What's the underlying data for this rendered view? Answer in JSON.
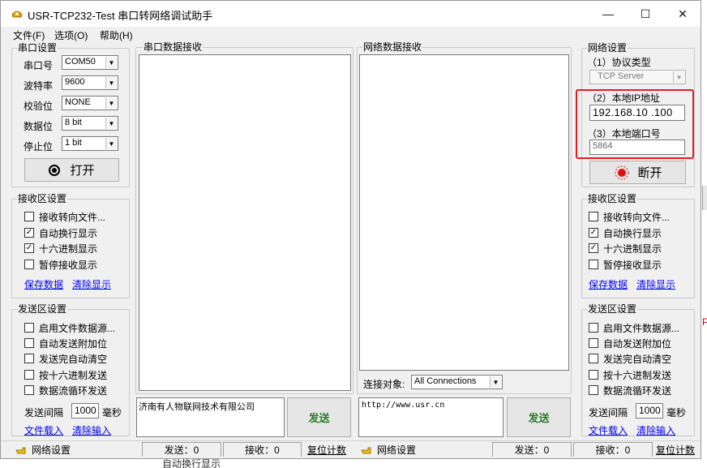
{
  "window": {
    "title": "USR-TCP232-Test 串口转网络调试助手",
    "controls": {
      "minimize": "—",
      "maximize": "☐",
      "close": "✕"
    }
  },
  "menu": [
    "文件(F)",
    "选项(O)",
    "帮助(H)"
  ],
  "serial_settings": {
    "title": "串口设置",
    "fields": [
      {
        "label": "串口号",
        "value": "COM50"
      },
      {
        "label": "波特率",
        "value": "9600"
      },
      {
        "label": "校验位",
        "value": "NONE"
      },
      {
        "label": "数据位",
        "value": "8 bit"
      },
      {
        "label": "停止位",
        "value": "1 bit"
      }
    ],
    "open_button": "打开"
  },
  "left_recv": {
    "title": "接收区设置",
    "options": [
      {
        "label": "接收转向文件...",
        "checked": false
      },
      {
        "label": "自动换行显示",
        "checked": true
      },
      {
        "label": "十六进制显示",
        "checked": true
      },
      {
        "label": "暂停接收显示",
        "checked": false
      }
    ],
    "save_link": "保存数据",
    "clear_link": "清除显示"
  },
  "left_send": {
    "title": "发送区设置",
    "options": [
      {
        "label": "启用文件数据源...",
        "checked": false
      },
      {
        "label": "自动发送附加位",
        "checked": false
      },
      {
        "label": "发送完自动清空",
        "checked": false
      },
      {
        "label": "按十六进制发送",
        "checked": false
      },
      {
        "label": "数据流循环发送",
        "checked": false
      }
    ],
    "interval_label": "发送间隔",
    "interval_value": "1000",
    "interval_unit": "毫秒",
    "load_link": "文件载入",
    "clear_link": "清除输入"
  },
  "serial_recv": {
    "title": "串口数据接收"
  },
  "serial_send": {
    "text": "济南有人物联网技术有限公司",
    "button": "发送"
  },
  "net_recv": {
    "title": "网络数据接收"
  },
  "connect": {
    "label": "连接对象:",
    "value": "All Connections"
  },
  "net_send": {
    "text": "http://www.usr.cn",
    "button": "发送"
  },
  "net_settings": {
    "title": "网络设置",
    "protocol_label": "（1）协议类型",
    "protocol_value": "TCP Server",
    "ip_label": "（2）本地IP地址",
    "ip_value": "192.168.10 .100",
    "port_label": "（3）本地端口号",
    "port_value": "5864",
    "disconnect_button": "断开"
  },
  "right_recv": {
    "title": "接收区设置",
    "options": [
      {
        "label": "接收转向文件...",
        "checked": false
      },
      {
        "label": "自动换行显示",
        "checked": true
      },
      {
        "label": "十六进制显示",
        "checked": true
      },
      {
        "label": "暂停接收显示",
        "checked": false
      }
    ],
    "save_link": "保存数据",
    "clear_link": "清除显示"
  },
  "right_send": {
    "title": "发送区设置",
    "options": [
      {
        "label": "启用文件数据源...",
        "checked": false
      },
      {
        "label": "自动发送附加位",
        "checked": false
      },
      {
        "label": "发送完自动清空",
        "checked": false
      },
      {
        "label": "按十六进制发送",
        "checked": false
      },
      {
        "label": "数据流循环发送",
        "checked": false
      }
    ],
    "interval_label": "发送间隔",
    "interval_value": "1000",
    "interval_unit": "毫秒",
    "load_link": "文件载入",
    "clear_link": "清除输入"
  },
  "status": {
    "left_label": "网络设置",
    "left_send": "发送：0",
    "left_recv": "接收：0",
    "left_reset": "复位计数",
    "right_label": "网络设置",
    "right_send": "发送：0",
    "right_recv": "接收：0",
    "right_reset": "复位计数"
  },
  "background_fragment": "自动换行显示",
  "colors": {
    "highlight_box": "#e02020",
    "link": "#0000ee",
    "send_text": "#2a7a2a"
  }
}
